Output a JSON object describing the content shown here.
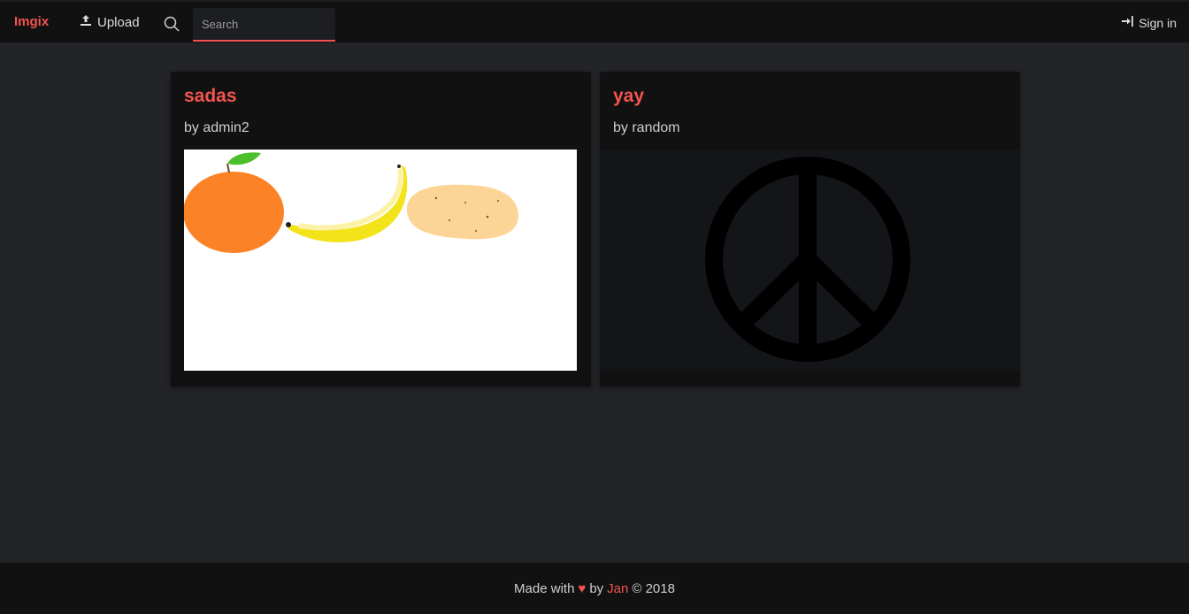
{
  "navbar": {
    "brand": "Imgix",
    "upload_label": "Upload",
    "search_placeholder": "Search",
    "signin_label": "Sign in",
    "accent_color": "#f2544f"
  },
  "posts": [
    {
      "title": "sadas",
      "author": "by admin2",
      "image_icon": "fruit-drawing"
    },
    {
      "title": "yay",
      "author": "by random",
      "image_icon": "peace-sign"
    }
  ],
  "footer": {
    "made_with": "Made with",
    "heart": "♥",
    "by": "by",
    "author": "Jan",
    "copyright": "© 2018"
  }
}
